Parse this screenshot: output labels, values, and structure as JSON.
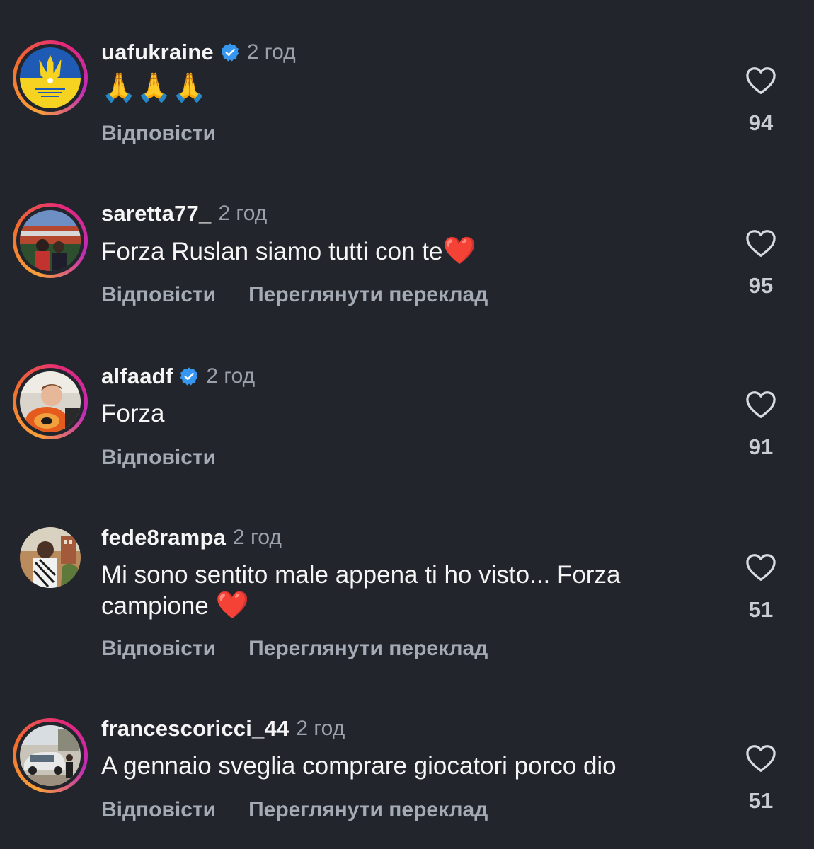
{
  "colors": {
    "background": "#22252c",
    "verified": "#3797f0",
    "muted": "#9ba1ab",
    "heart": "#e0162b"
  },
  "comments": [
    {
      "username": "uafukraine",
      "verified": true,
      "time": "2 год",
      "text": "🙏🙏🙏",
      "actions": [
        "Відповісти"
      ],
      "likes": "94",
      "avatar": "ukrainian-football-association-logo"
    },
    {
      "username": "saretta77_",
      "verified": false,
      "time": "2 год",
      "text": "Forza Ruslan siamo tutti con te",
      "text_emoji": "❤️",
      "actions": [
        "Відповісти",
        "Переглянути переклад"
      ],
      "likes": "95",
      "avatar": "stadium-photo"
    },
    {
      "username": "alfaadf",
      "verified": true,
      "time": "2 год",
      "text": "Forza",
      "actions": [
        "Відповісти"
      ],
      "likes": "91",
      "avatar": "person-photo"
    },
    {
      "username": "fede8rampa",
      "verified": false,
      "time": "2 год",
      "text": "Mi sono sentito male appena ti ho visto... Forza campione",
      "text_emoji": "❤️",
      "actions": [
        "Відповісти",
        "Переглянути переклад"
      ],
      "likes": "51",
      "avatar": "outdoor-photo"
    },
    {
      "username": "francescoricci_44",
      "verified": false,
      "time": "2 год",
      "text": "A gennaio sveglia comprare giocatori porco dio",
      "actions": [
        "Відповісти",
        "Переглянути переклад"
      ],
      "likes": "51",
      "avatar": "car-photo"
    }
  ]
}
